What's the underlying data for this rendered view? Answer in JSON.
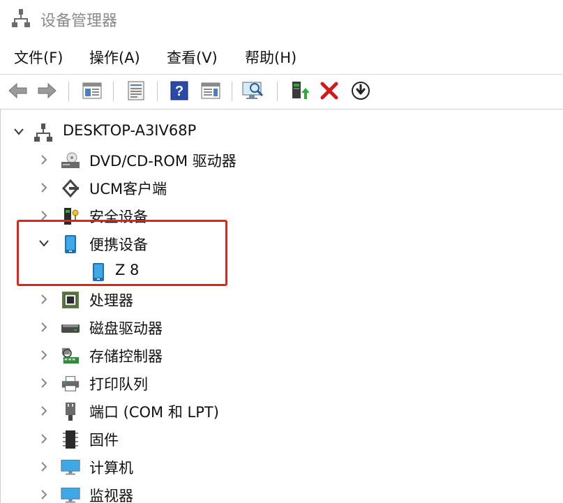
{
  "window": {
    "title": "设备管理器"
  },
  "menu": {
    "file": "文件(F)",
    "action": "操作(A)",
    "view": "查看(V)",
    "help": "帮助(H)"
  },
  "tree": {
    "root": "DESKTOP-A3IV68P",
    "items": [
      {
        "label": "DVD/CD-ROM 驱动器",
        "icon": "dvd-drive-icon"
      },
      {
        "label": "UCM客户端",
        "icon": "ucm-icon"
      },
      {
        "label": "安全设备",
        "icon": "security-device-icon"
      },
      {
        "label": "便携设备",
        "icon": "portable-device-icon",
        "expanded": true,
        "children": [
          {
            "label": "Z 8",
            "icon": "phone-icon"
          }
        ]
      },
      {
        "label": "处理器",
        "icon": "processor-icon"
      },
      {
        "label": "磁盘驱动器",
        "icon": "disk-drive-icon"
      },
      {
        "label": "存储控制器",
        "icon": "storage-controller-icon"
      },
      {
        "label": "打印队列",
        "icon": "printer-icon"
      },
      {
        "label": "端口 (COM 和 LPT)",
        "icon": "port-icon"
      },
      {
        "label": "固件",
        "icon": "firmware-icon"
      },
      {
        "label": "计算机",
        "icon": "computer-icon"
      },
      {
        "label": "监视器",
        "icon": "monitor-icon"
      }
    ]
  },
  "colors": {
    "highlight_box": "#e2231a",
    "toolbar_green": "#2e8b2e",
    "delete_red": "#d11a1a",
    "help_blue": "#2a4aa8"
  }
}
